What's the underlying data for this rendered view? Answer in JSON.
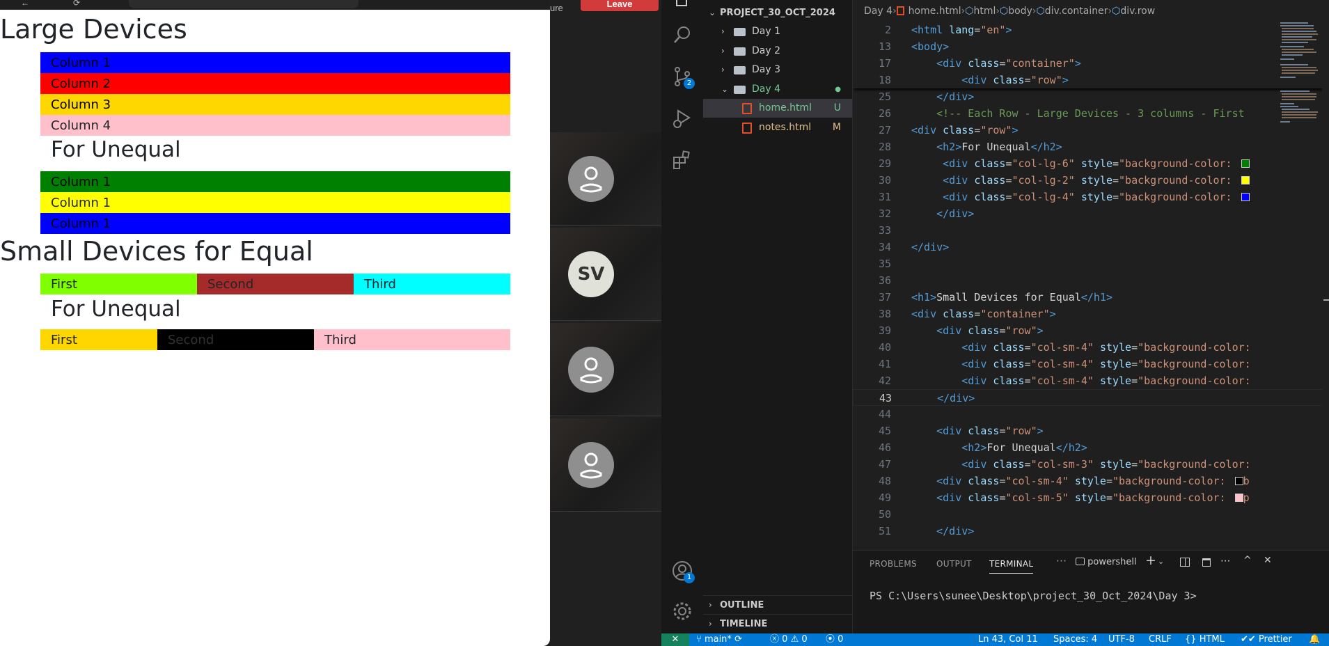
{
  "browser": {
    "topbar_glyphs": [
      "←",
      "⟳"
    ],
    "h1_large": "Large Devices",
    "large_rows": [
      {
        "label": "Column 1",
        "bg": "#0000ff",
        "fg": "#000000"
      },
      {
        "label": "Column 2",
        "bg": "#ff0000",
        "fg": "#000000"
      },
      {
        "label": "Column 3",
        "bg": "#ffd700",
        "fg": "#000000"
      },
      {
        "label": "Column 4",
        "bg": "#ffc0cb",
        "fg": "#212529"
      }
    ],
    "h2_unequal_1": "For Unequal",
    "unequal_rows": [
      {
        "label": "Column 1",
        "bg": "#008000",
        "fg": "#000000"
      },
      {
        "label": "Column 1",
        "bg": "#ffff00",
        "fg": "#212529"
      },
      {
        "label": "Column 1",
        "bg": "#0000ff",
        "fg": "#000000"
      }
    ],
    "h1_small": "Small Devices for Equal",
    "small_equal": [
      {
        "label": "First",
        "bg": "#7fff00",
        "fg": "#212529"
      },
      {
        "label": "Second",
        "bg": "#a52a2a",
        "fg": "#212529"
      },
      {
        "label": "Third",
        "bg": "#00ffff",
        "fg": "#212529"
      }
    ],
    "h2_unequal_2": "For Unequal",
    "small_unequal": [
      {
        "label": "First",
        "bg": "#ffd700",
        "fg": "#212529"
      },
      {
        "label": "Second",
        "bg": "#000000",
        "fg": "#333333"
      },
      {
        "label": "Third",
        "bg": "#ffc0cb",
        "fg": "#212529"
      }
    ]
  },
  "meeting": {
    "leave_label": "Leave",
    "partial_text": "ure",
    "participants": [
      {
        "initials": "",
        "kind": "generic"
      },
      {
        "initials": "SV",
        "kind": "initials"
      },
      {
        "initials": "",
        "kind": "generic"
      },
      {
        "initials": "",
        "kind": "generic"
      }
    ]
  },
  "vscode": {
    "activity": {
      "source_control_badge": "2",
      "accounts_badge": "1",
      "icons": [
        "files-icon",
        "search-icon",
        "source-control-icon",
        "run-debug-icon",
        "extensions-icon"
      ]
    },
    "explorer": {
      "project": "PROJECT_30_OCT_2024",
      "items": [
        {
          "label": "Day 1",
          "type": "folder",
          "status": ""
        },
        {
          "label": "Day 2",
          "type": "folder",
          "status": ""
        },
        {
          "label": "Day 3",
          "type": "folder",
          "status": ""
        },
        {
          "label": "Day 4",
          "type": "folder-open",
          "status": "●"
        },
        {
          "label": "home.html",
          "type": "file",
          "status": "U"
        },
        {
          "label": "notes.html",
          "type": "file",
          "status": "M"
        }
      ],
      "outline": "OUTLINE",
      "timeline": "TIMELINE"
    },
    "breadcrumb": [
      "Day 4",
      "home.html",
      "html",
      "body",
      "div.container",
      "div.row"
    ],
    "code": [
      {
        "n": "2",
        "html": "<span class=\"tag\">&lt;html</span> <span class=\"attr\">lang</span>=<span class=\"str\">\"en\"</span><span class=\"tag\">&gt;</span>"
      },
      {
        "n": "13",
        "html": "<span class=\"tag\">&lt;body&gt;</span>"
      },
      {
        "n": "17",
        "html": "    <span class=\"tag\">&lt;div</span> <span class=\"attr\">class</span>=<span class=\"str\">\"container\"</span><span class=\"tag\">&gt;</span>"
      },
      {
        "n": "18",
        "html": "        <span class=\"tag\">&lt;div</span> <span class=\"attr\">class</span>=<span class=\"str\">\"row\"</span><span class=\"tag\">&gt;</span>"
      },
      {
        "n": "25",
        "html": "    <span class=\"tag\">&lt;/div&gt;</span>"
      },
      {
        "n": "26",
        "html": "    <span class=\"cmt\">&lt;!-- Each Row - Large Devices - 3 columns - First</span>"
      },
      {
        "n": "27",
        "html": "<span class=\"tag\">&lt;div</span> <span class=\"attr\">class</span>=<span class=\"str\">\"row\"</span><span class=\"tag\">&gt;</span>"
      },
      {
        "n": "28",
        "html": "    <span class=\"tag\">&lt;h2&gt;</span><span class=\"txt\">For Unequal</span><span class=\"tag\">&lt;/h2&gt;</span>"
      },
      {
        "n": "29",
        "html": "     <span class=\"tag\">&lt;div</span> <span class=\"attr\">class</span>=<span class=\"str\">\"col-lg-6\"</span> <span class=\"attr\">style</span>=<span class=\"str\">\"background-color: </span><span class=\"swatch\" style=\"background:#008000\"></span>"
      },
      {
        "n": "30",
        "html": "     <span class=\"tag\">&lt;div</span> <span class=\"attr\">class</span>=<span class=\"str\">\"col-lg-2\"</span> <span class=\"attr\">style</span>=<span class=\"str\">\"background-color: </span><span class=\"swatch\" style=\"background:#ffff00\"></span>"
      },
      {
        "n": "31",
        "html": "     <span class=\"tag\">&lt;div</span> <span class=\"attr\">class</span>=<span class=\"str\">\"col-lg-4\"</span> <span class=\"attr\">style</span>=<span class=\"str\">\"background-color: </span><span class=\"swatch\" style=\"background:#0000ff\"></span>"
      },
      {
        "n": "32",
        "html": "    <span class=\"tag\">&lt;/div&gt;</span>"
      },
      {
        "n": "33",
        "html": ""
      },
      {
        "n": "34",
        "html": "<span class=\"tag\">&lt;/div&gt;</span>"
      },
      {
        "n": "35",
        "html": ""
      },
      {
        "n": "36",
        "html": ""
      },
      {
        "n": "37",
        "html": "<span class=\"tag\">&lt;h1&gt;</span><span class=\"txt\">Small Devices for Equal</span><span class=\"tag\">&lt;/h1&gt;</span>"
      },
      {
        "n": "38",
        "html": "<span class=\"tag\">&lt;div</span> <span class=\"attr\">class</span>=<span class=\"str\">\"container\"</span><span class=\"tag\">&gt;</span>"
      },
      {
        "n": "39",
        "html": "    <span class=\"tag\">&lt;div</span> <span class=\"attr\">class</span>=<span class=\"str\">\"row\"</span><span class=\"tag\">&gt;</span>"
      },
      {
        "n": "40",
        "html": "        <span class=\"tag\">&lt;div</span> <span class=\"attr\">class</span>=<span class=\"str\">\"col-sm-4\"</span> <span class=\"attr\">style</span>=<span class=\"str\">\"background-color:</span>"
      },
      {
        "n": "41",
        "html": "        <span class=\"tag\">&lt;div</span> <span class=\"attr\">class</span>=<span class=\"str\">\"col-sm-4\"</span> <span class=\"attr\">style</span>=<span class=\"str\">\"background-color:</span>"
      },
      {
        "n": "42",
        "html": "        <span class=\"tag\">&lt;div</span> <span class=\"attr\">class</span>=<span class=\"str\">\"col-sm-4\"</span> <span class=\"attr\">style</span>=<span class=\"str\">\"background-color:</span>"
      },
      {
        "n": "43",
        "html": "    <span class=\"tag\">&lt;/div&gt;</span>",
        "current": true
      },
      {
        "n": "44",
        "html": ""
      },
      {
        "n": "45",
        "html": "    <span class=\"tag\">&lt;div</span> <span class=\"attr\">class</span>=<span class=\"str\">\"row\"</span><span class=\"tag\">&gt;</span>"
      },
      {
        "n": "46",
        "html": "        <span class=\"tag\">&lt;h2&gt;</span><span class=\"txt\">For Unequal</span><span class=\"tag\">&lt;/h2&gt;</span>"
      },
      {
        "n": "47",
        "html": "        <span class=\"tag\">&lt;div</span> <span class=\"attr\">class</span>=<span class=\"str\">\"col-sm-3\"</span> <span class=\"attr\">style</span>=<span class=\"str\">\"background-color:</span>"
      },
      {
        "n": "48",
        "html": "    <span class=\"tag\">&lt;div</span> <span class=\"attr\">class</span>=<span class=\"str\">\"col-sm-4\"</span> <span class=\"attr\">style</span>=<span class=\"str\">\"background-color: </span><span class=\"swatch\" style=\"background:#000000\"></span><span class=\"str\">b</span>"
      },
      {
        "n": "49",
        "html": "    <span class=\"tag\">&lt;div</span> <span class=\"attr\">class</span>=<span class=\"str\">\"col-sm-5\"</span> <span class=\"attr\">style</span>=<span class=\"str\">\"background-color: </span><span class=\"swatch\" style=\"background:#ffc0cb\"></span><span class=\"str\">p</span>"
      },
      {
        "n": "50",
        "html": ""
      },
      {
        "n": "51",
        "html": "    <span class=\"tag\">&lt;/div&gt;</span>"
      }
    ],
    "panel": {
      "tabs": [
        "PROBLEMS",
        "OUTPUT",
        "TERMINAL"
      ],
      "active_tab": "TERMINAL",
      "shell": "powershell",
      "prompt": "PS C:\\Users\\sunee\\Desktop\\project_30_Oct_2024\\Day 3>"
    },
    "status": {
      "branch": "main*",
      "errors": "0",
      "warnings": "0",
      "ports": "0",
      "position": "Ln 43, Col 11",
      "spaces": "Spaces: 4",
      "encoding": "UTF-8",
      "eol": "CRLF",
      "language": "HTML",
      "formatter": "Prettier"
    }
  }
}
